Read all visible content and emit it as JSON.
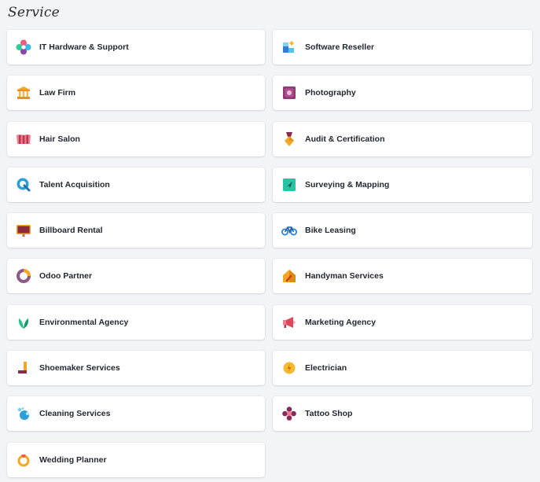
{
  "section": {
    "title": "Service"
  },
  "items": [
    {
      "label": "IT Hardware & Support",
      "icon": "it-hardware-icon"
    },
    {
      "label": "Software Reseller",
      "icon": "software-reseller-icon"
    },
    {
      "label": "Law Firm",
      "icon": "law-firm-icon"
    },
    {
      "label": "Photography",
      "icon": "photography-icon"
    },
    {
      "label": "Hair Salon",
      "icon": "hair-salon-icon"
    },
    {
      "label": "Audit & Certification",
      "icon": "audit-certification-icon"
    },
    {
      "label": "Talent Acquisition",
      "icon": "talent-acquisition-icon"
    },
    {
      "label": "Surveying & Mapping",
      "icon": "surveying-mapping-icon"
    },
    {
      "label": "Billboard Rental",
      "icon": "billboard-rental-icon"
    },
    {
      "label": "Bike Leasing",
      "icon": "bike-leasing-icon"
    },
    {
      "label": "Odoo Partner",
      "icon": "odoo-partner-icon"
    },
    {
      "label": "Handyman Services",
      "icon": "handyman-services-icon"
    },
    {
      "label": "Environmental Agency",
      "icon": "environmental-agency-icon"
    },
    {
      "label": "Marketing Agency",
      "icon": "marketing-agency-icon"
    },
    {
      "label": "Shoemaker Services",
      "icon": "shoemaker-services-icon"
    },
    {
      "label": "Electrician",
      "icon": "electrician-icon"
    },
    {
      "label": "Cleaning Services",
      "icon": "cleaning-services-icon"
    },
    {
      "label": "Tattoo Shop",
      "icon": "tattoo-shop-icon"
    },
    {
      "label": "Wedding Planner",
      "icon": "wedding-planner-icon"
    }
  ]
}
